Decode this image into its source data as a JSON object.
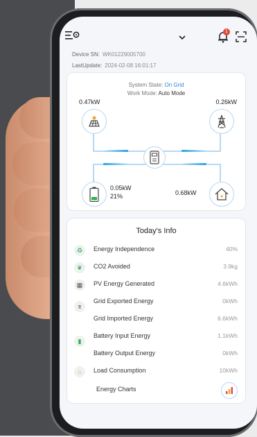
{
  "colors": {
    "accent": "#2f7fd8",
    "flow": "#22a1e2",
    "badge": "#e0473e"
  },
  "header": {
    "menu_icon": "menu-icon",
    "dropdown_icon": "chevron-down-icon",
    "notification_count": "1",
    "scan_icon": "scan-icon"
  },
  "device": {
    "sn_label": "Device SN:",
    "sn_value": "WK01229005700",
    "update_label": "LastUpdate:",
    "update_value": "2024-02-08 16:01:17"
  },
  "flow": {
    "state_label": "System State:",
    "state_value": "On Grid",
    "mode_label": "Work Mode:",
    "mode_value": "Auto Mode",
    "solar_power": "0.47kW",
    "grid_power": "0.26kW",
    "battery_power": "0.05kW",
    "battery_soc": "21%",
    "load_power": "0.68kW"
  },
  "info": {
    "title": "Today's Info",
    "rows": [
      {
        "label": "Energy Independence",
        "value": "40%"
      },
      {
        "label": "CO2 Avoided",
        "value": "3.9kg"
      },
      {
        "label": "PV Energy Generated",
        "value": "4.6kWh"
      },
      {
        "label": "Grid  Exported Energy",
        "value": "0kWh"
      },
      {
        "label": "Grid  Imported Energy",
        "value": "6.6kWh"
      },
      {
        "label": "Battery Input Energy",
        "value": "1.1kWh"
      },
      {
        "label": "Battery Output Energy",
        "value": "0kWh"
      },
      {
        "label": "Load Consumption",
        "value": "10kWh"
      }
    ],
    "charts_label": "Energy Charts"
  }
}
